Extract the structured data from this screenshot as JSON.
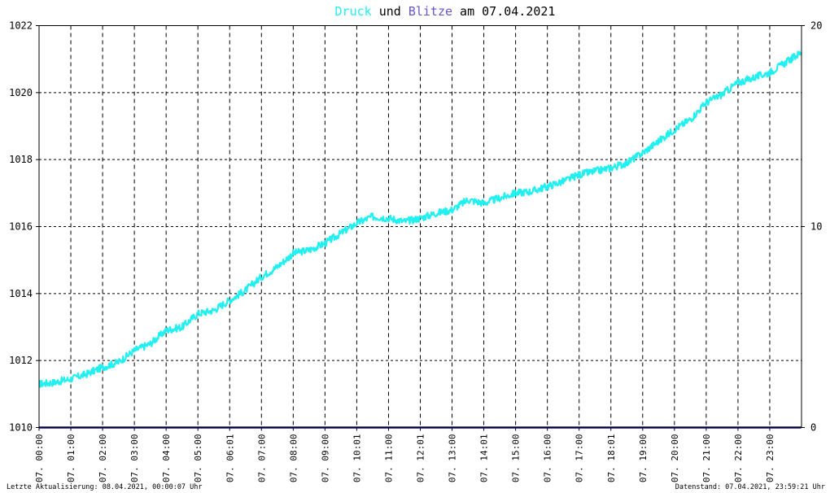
{
  "header": {
    "title_part1": "Druck",
    "title_part2": " und ",
    "title_part3": "Blitze",
    "title_part4": " am 07.04.2021"
  },
  "footer": {
    "left": "Letzte Aktualisierung: 08.04.2021, 00:00:07 Uhr",
    "right": "Datenstand: 07.04.2021, 23:59:21 Uhr"
  },
  "colors": {
    "pressure": "#22f0f0",
    "lightning": "#6655cc",
    "baseline": "#0a0a80",
    "grid": "#000000"
  },
  "chart_data": {
    "type": "line",
    "title": "Druck und Blitze am 07.04.2021",
    "y_left_ticks": [
      "1010",
      "1012",
      "1014",
      "1016",
      "1018",
      "1020",
      "1022"
    ],
    "y_right_ticks": [
      "0",
      "10",
      "20"
    ],
    "ylim_left": [
      1010,
      1022
    ],
    "ylim_right": [
      0,
      20
    ],
    "x_tick_labels": [
      "07. 00:00",
      "07. 01:00",
      "07. 02:00",
      "07. 03:00",
      "07. 04:00",
      "07. 05:00",
      "07. 06:01",
      "07. 07:00",
      "07. 08:00",
      "07. 09:00",
      "07. 10:01",
      "07. 11:00",
      "07. 12:01",
      "07. 13:00",
      "07. 14:01",
      "07. 15:00",
      "07. 16:00",
      "07. 17:00",
      "07. 18:01",
      "07. 19:00",
      "07. 20:00",
      "07. 21:00",
      "07. 22:00",
      "07. 23:00"
    ],
    "grid": true,
    "series": [
      {
        "name": "Druck",
        "axis": "left",
        "x_hours": [
          0,
          0.5,
          1,
          1.5,
          2,
          2.5,
          3,
          3.5,
          4,
          4.5,
          5,
          5.5,
          6,
          6.5,
          7,
          7.5,
          8,
          8.5,
          9,
          9.5,
          10,
          10.5,
          11,
          11.5,
          12,
          12.5,
          13,
          13.5,
          14,
          14.5,
          15,
          15.5,
          16,
          16.5,
          17,
          17.5,
          18,
          18.5,
          19,
          19.5,
          20,
          20.5,
          21,
          21.5,
          22,
          22.5,
          23,
          23.5,
          23.99
        ],
        "values": [
          1011.3,
          1011.35,
          1011.45,
          1011.6,
          1011.8,
          1011.95,
          1012.3,
          1012.5,
          1012.9,
          1013.0,
          1013.4,
          1013.5,
          1013.8,
          1014.1,
          1014.5,
          1014.8,
          1015.2,
          1015.3,
          1015.5,
          1015.8,
          1016.1,
          1016.3,
          1016.25,
          1016.15,
          1016.25,
          1016.4,
          1016.5,
          1016.8,
          1016.7,
          1016.85,
          1017.0,
          1017.05,
          1017.2,
          1017.35,
          1017.55,
          1017.65,
          1017.75,
          1017.9,
          1018.2,
          1018.55,
          1018.9,
          1019.2,
          1019.7,
          1019.95,
          1020.3,
          1020.45,
          1020.6,
          1020.9,
          1021.2
        ]
      },
      {
        "name": "Blitze",
        "axis": "right",
        "x_hours": [
          0,
          23.99
        ],
        "values": [
          0,
          0
        ]
      }
    ]
  }
}
